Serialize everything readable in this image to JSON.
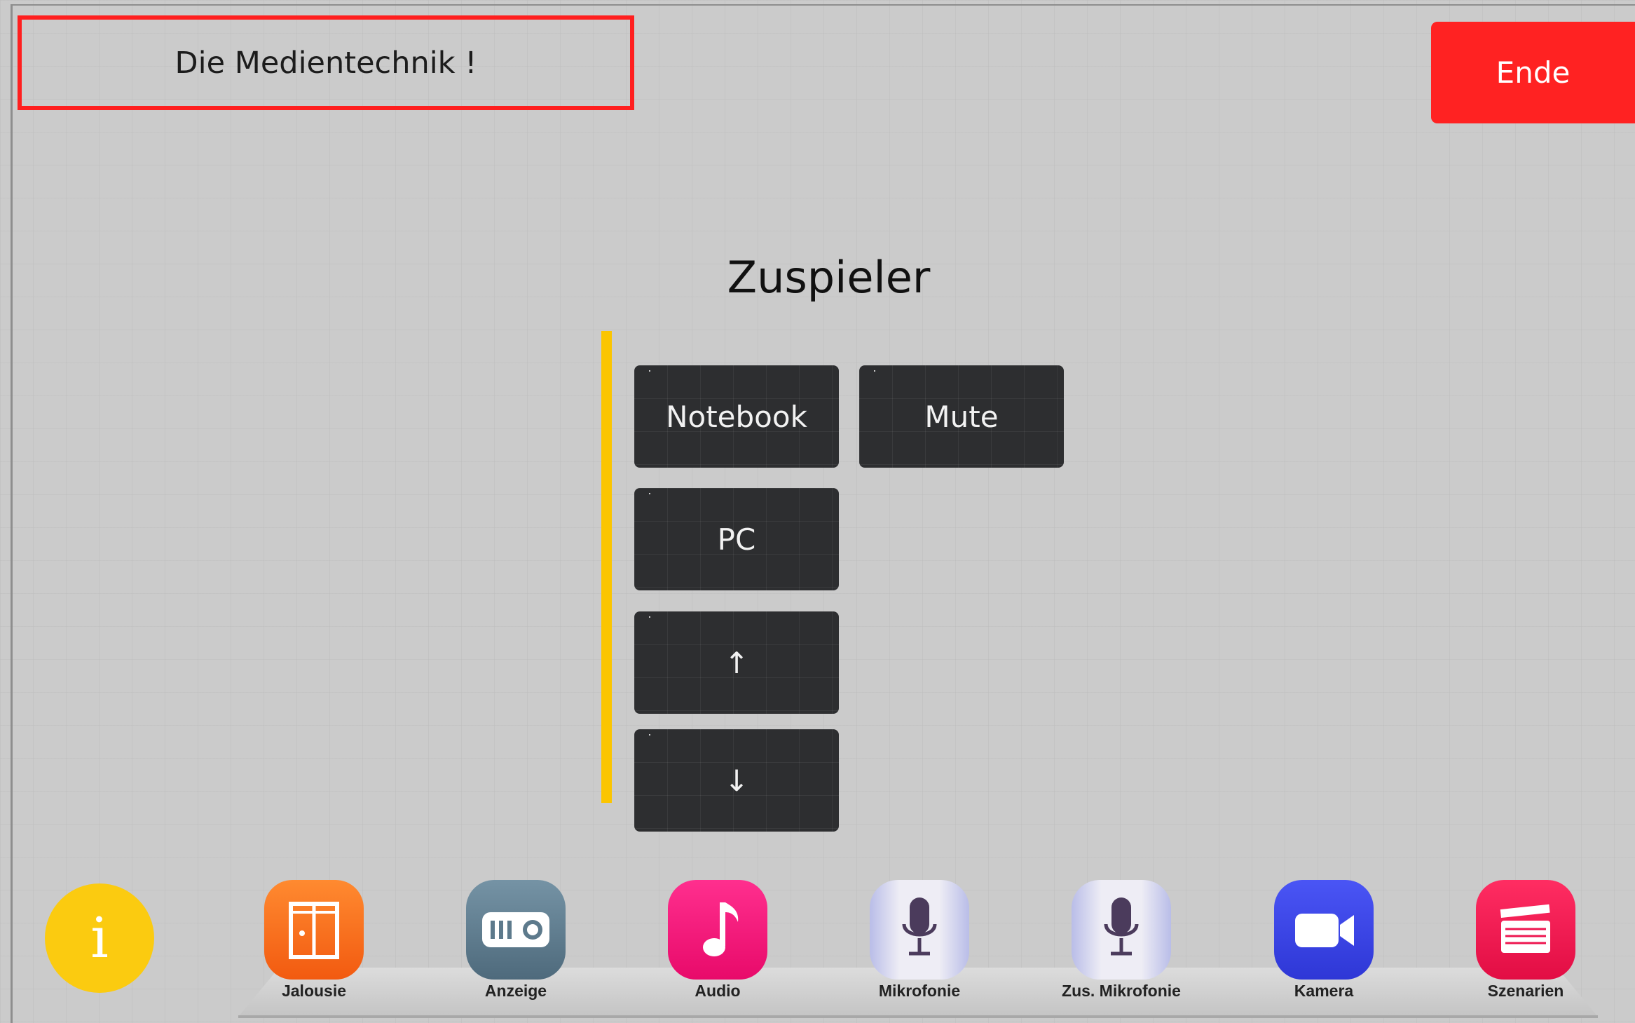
{
  "header": {
    "title": "Die Medientechnik !",
    "end_label": "Ende"
  },
  "section": {
    "title": "Zuspieler"
  },
  "buttons": {
    "notebook": "Notebook",
    "mute": "Mute",
    "pc": "PC",
    "up": "↑",
    "down": "↓"
  },
  "dock": {
    "info_glyph": "i",
    "items": [
      {
        "label": "Jalousie",
        "icon": "blinds-icon",
        "color": "#fb6a18"
      },
      {
        "label": "Anzeige",
        "icon": "projector-icon",
        "color": "#5d7a8c"
      },
      {
        "label": "Audio",
        "icon": "music-note-icon",
        "color": "#f4147a"
      },
      {
        "label": "Mikrofonie",
        "icon": "microphone-icon",
        "color": "#dcdbe8"
      },
      {
        "label": "Zus. Mikrofonie",
        "icon": "microphone-icon",
        "color": "#dcdbe8"
      },
      {
        "label": "Kamera",
        "icon": "video-camera-icon",
        "color": "#3a44e8"
      },
      {
        "label": "Szenarien",
        "icon": "clapperboard-icon",
        "color": "#ee1650"
      }
    ]
  },
  "colors": {
    "accent_red": "#ff2222",
    "accent_yellow": "#fbc500",
    "button_dark": "#2d2e30"
  }
}
